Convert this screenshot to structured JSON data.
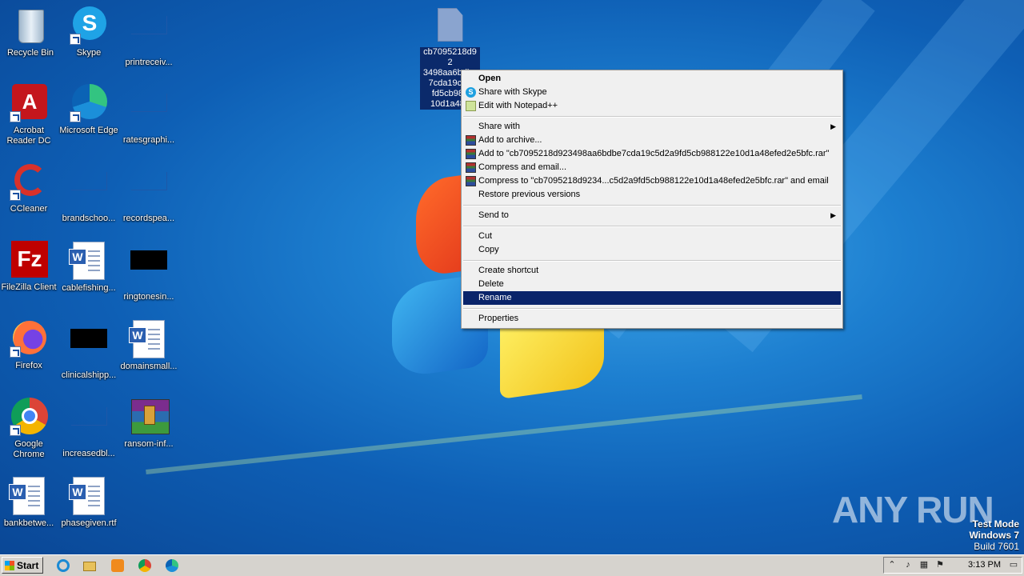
{
  "desktop": {
    "icons": [
      {
        "id": "recycle-bin",
        "label": "Recycle Bin"
      },
      {
        "id": "skype",
        "label": "Skype"
      },
      {
        "id": "printreceiv",
        "label": "printreceiv..."
      },
      {
        "id": "acrobat",
        "label": "Acrobat Reader DC"
      },
      {
        "id": "edge",
        "label": "Microsoft Edge"
      },
      {
        "id": "ratesgraphi",
        "label": "ratesgraphi..."
      },
      {
        "id": "ccleaner",
        "label": "CCleaner"
      },
      {
        "id": "brandschoo",
        "label": "brandschoo..."
      },
      {
        "id": "recordspea",
        "label": "recordspea..."
      },
      {
        "id": "filezilla",
        "label": "FileZilla Client"
      },
      {
        "id": "cablefishing",
        "label": "cablefishing..."
      },
      {
        "id": "ringtonesin",
        "label": "ringtonesin..."
      },
      {
        "id": "firefox",
        "label": "Firefox"
      },
      {
        "id": "clinicalshipp",
        "label": "clinicalshipp..."
      },
      {
        "id": "domainsmall",
        "label": "domainsmall..."
      },
      {
        "id": "chrome",
        "label": "Google Chrome"
      },
      {
        "id": "increasedbl",
        "label": "increasedbl..."
      },
      {
        "id": "ransom",
        "label": "ransom-inf..."
      },
      {
        "id": "bankbetwe",
        "label": "bankbetwe..."
      },
      {
        "id": "phasegiven",
        "label": "phasegiven.rtf"
      }
    ],
    "selected_file": {
      "name": "cb7095218d923498aa6bdbe7cda19c5d2a9fd5cb988122e10d1a48efed2e5bfc",
      "visible_lines": [
        "cb7095218d92",
        "3498aa6bdbe",
        "7cda19c5d",
        "fd5cb988",
        "10d1a48e",
        "e5bfc"
      ]
    }
  },
  "context_menu": {
    "items": {
      "open": "Open",
      "share_skype": "Share with Skype",
      "edit_npp": "Edit with Notepad++",
      "share_with": "Share with",
      "add_archive": "Add to archive...",
      "add_to_rar": "Add to \"cb7095218d923498aa6bdbe7cda19c5d2a9fd5cb988122e10d1a48efed2e5bfc.rar\"",
      "compress_email": "Compress and email...",
      "compress_to_rar_email": "Compress to \"cb7095218d9234...c5d2a9fd5cb988122e10d1a48efed2e5bfc.rar\" and email",
      "restore": "Restore previous versions",
      "send_to": "Send to",
      "cut": "Cut",
      "copy": "Copy",
      "create_shortcut": "Create shortcut",
      "delete": "Delete",
      "rename": "Rename",
      "properties": "Properties"
    },
    "highlighted": "Rename"
  },
  "watermark": {
    "text": "ANY RUN"
  },
  "testmode": {
    "line1": "Test Mode",
    "line2": "Windows 7",
    "line3": "Build 7601"
  },
  "taskbar": {
    "start_label": "Start",
    "pinned": [
      "internet-explorer-icon",
      "file-explorer-icon",
      "media-player-icon",
      "chrome-icon",
      "edge-icon"
    ],
    "clock": "3:13 PM"
  },
  "colors": {
    "menu_highlight": "#0a246a",
    "desktop": "#1d7fd0",
    "taskbar": "#d6d3ce"
  }
}
